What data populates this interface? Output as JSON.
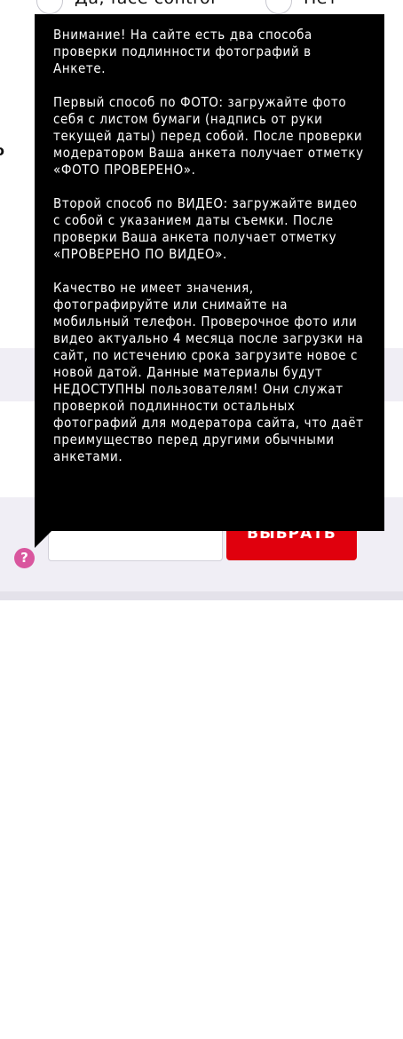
{
  "verification": {
    "option_yes_label": "Да, face control",
    "option_no_label": "Нет"
  },
  "side_fragment": "о",
  "upload": {
    "input_value": "",
    "choose_button_label": "ВЫБРАТЬ",
    "help_icon_glyph": "?"
  },
  "tooltip": {
    "paragraph_1": "Внимание! На сайте есть два способа проверки подлинности фотографий в Анкете.",
    "paragraph_2": "Первый способ по ФОТО: загружайте фото себя с листом бумаги (надпись от руки текущей даты) перед собой. После проверки модератором Ваша анкета получает отметку «ФОТО ПРОВЕРЕНО».",
    "paragraph_3": "Второй способ по ВИДЕО: загружайте видео с собой с указанием даты съемки. После проверки Ваша анкета получает отметку «ПРОВЕРЕНО ПО ВИДЕО».",
    "paragraph_4": "Качество не имеет значения, фотографируйте или снимайте на мобильный телефон. Проверочное фото или видео актуально 4 месяца после загрузки на сайт, по истечению срока загрузите новое с новой датой. Данные материалы будут НЕДОСТУПНЫ пользователям! Они служат проверкой подлинности остальных фотографий для модератора сайта, что даёт преимущество перед другими обычными анкетами."
  },
  "colors": {
    "accent_red": "#e0000d",
    "help_pink": "#d9569e",
    "tooltip_bg": "#000000",
    "band_bg": "#f0eef5"
  }
}
